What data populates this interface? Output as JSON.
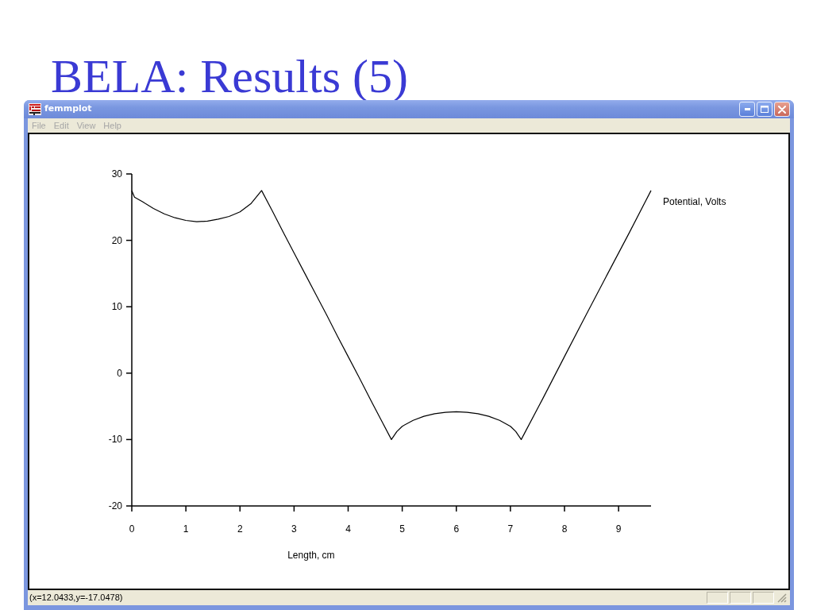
{
  "slide": {
    "title": "BELA: Results (5)"
  },
  "window": {
    "title": "femmplot",
    "menu": [
      "File",
      "Edit",
      "View",
      "Help"
    ],
    "plot": {
      "chart_data": {
        "type": "line",
        "xlabel": "Length, cm",
        "x": [
          0,
          0.05,
          0.2,
          0.4,
          0.6,
          0.8,
          1.0,
          1.2,
          1.4,
          1.6,
          1.8,
          2.0,
          2.2,
          2.4,
          2.6,
          2.8,
          3.0,
          3.2,
          3.4,
          3.6,
          3.8,
          4.0,
          4.2,
          4.4,
          4.6,
          4.8,
          4.9,
          5.0,
          5.2,
          5.4,
          5.6,
          5.8,
          6.0,
          6.2,
          6.4,
          6.6,
          6.8,
          7.0,
          7.1,
          7.2,
          7.6,
          8.0,
          8.4,
          8.8,
          9.2,
          9.6
        ],
        "series": [
          {
            "name": "Potential, Volts",
            "values": [
              27.5,
              26.5,
              25.8,
              24.8,
              24.0,
              23.4,
              23.0,
              22.8,
              22.9,
              23.2,
              23.6,
              24.3,
              25.5,
              27.5,
              24.4,
              21.2,
              18.1,
              15.0,
              11.9,
              8.8,
              5.6,
              2.5,
              -0.6,
              -3.8,
              -6.9,
              -10.0,
              -8.8,
              -8.0,
              -7.1,
              -6.5,
              -6.1,
              -5.9,
              -5.8,
              -5.9,
              -6.1,
              -6.5,
              -7.1,
              -8.0,
              -8.8,
              -10.0,
              -3.8,
              2.5,
              8.8,
              15.0,
              21.2,
              27.5
            ]
          }
        ],
        "xlim": [
          0,
          9.6
        ],
        "ylim": [
          -20,
          30
        ],
        "xticks": [
          0,
          1,
          2,
          3,
          4,
          5,
          6,
          7,
          8,
          9
        ],
        "yticks": [
          -20,
          -10,
          0,
          10,
          20,
          30
        ]
      }
    },
    "status_bar": {
      "text": "(x=12.0433,y=-17.0478)"
    }
  }
}
